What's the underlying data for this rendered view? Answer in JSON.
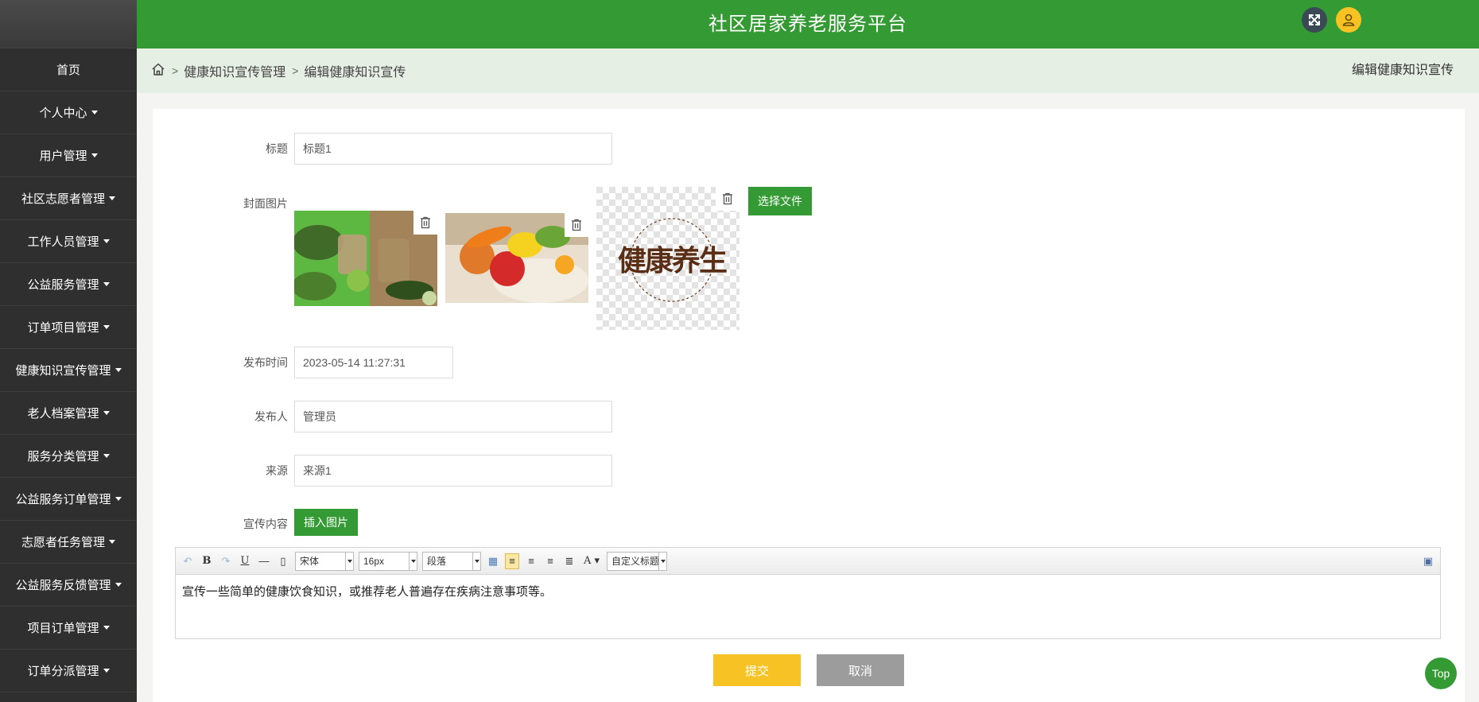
{
  "header": {
    "title": "社区居家养老服务平台"
  },
  "sidebar": {
    "items": [
      {
        "label": "首页",
        "dropdown": false
      },
      {
        "label": "个人中心",
        "dropdown": true
      },
      {
        "label": "用户管理",
        "dropdown": true
      },
      {
        "label": "社区志愿者管理",
        "dropdown": true
      },
      {
        "label": "工作人员管理",
        "dropdown": true
      },
      {
        "label": "公益服务管理",
        "dropdown": true
      },
      {
        "label": "订单项目管理",
        "dropdown": true
      },
      {
        "label": "健康知识宣传管理",
        "dropdown": true
      },
      {
        "label": "老人档案管理",
        "dropdown": true
      },
      {
        "label": "服务分类管理",
        "dropdown": true
      },
      {
        "label": "公益服务订单管理",
        "dropdown": true
      },
      {
        "label": "志愿者任务管理",
        "dropdown": true
      },
      {
        "label": "公益服务反馈管理",
        "dropdown": true
      },
      {
        "label": "项目订单管理",
        "dropdown": true
      },
      {
        "label": "订单分派管理",
        "dropdown": true
      }
    ]
  },
  "breadcrumb": {
    "level1": "健康知识宣传管理",
    "level2": "编辑健康知识宣传",
    "sep": ">"
  },
  "page_title": "编辑健康知识宣传",
  "form": {
    "title_label": "标题",
    "title_value": "标题1",
    "cover_label": "封面图片",
    "choose_file": "选择文件",
    "publish_time_label": "发布时间",
    "publish_time_value": "2023-05-14 11:27:31",
    "publisher_label": "发布人",
    "publisher_value": "管理员",
    "source_label": "来源",
    "source_value": "来源1",
    "content_label": "宣传内容",
    "insert_image": "插入图片",
    "cover_logo_text": "健康养生"
  },
  "editor": {
    "font": "宋体",
    "size": "16px",
    "paragraph": "段落",
    "custom_title": "自定义标题",
    "content": "宣传一些简单的健康饮食知识，或推荐老人普遍存在疾病注意事项等。"
  },
  "actions": {
    "submit": "提交",
    "cancel": "取消",
    "top": "Top"
  },
  "colors": {
    "primary": "#349a33",
    "sidebar": "#2f2f2f",
    "accent": "#f7c324"
  }
}
